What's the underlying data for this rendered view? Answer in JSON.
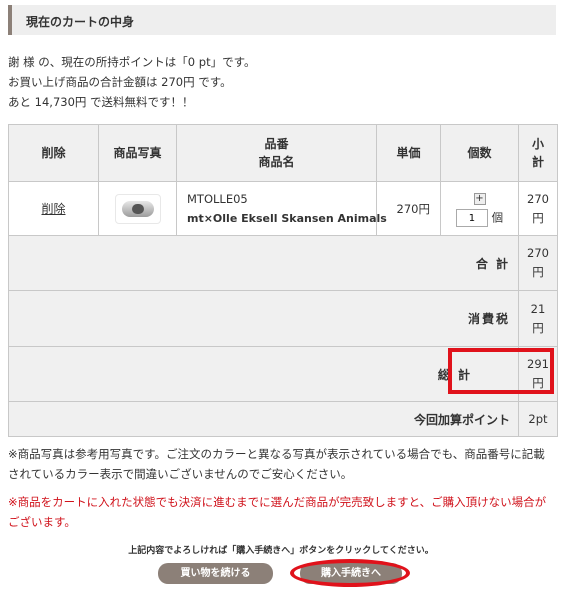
{
  "heading": "現在のカートの中身",
  "intro": {
    "line1": "謝 様 の、現在の所持ポイントは「0 pt」です。",
    "line2": "お買い上げ商品の合計金額は 270円 です。",
    "line3": "あと 14,730円 で送料無料です！！"
  },
  "table": {
    "headers": {
      "delete": "削除",
      "photo": "商品写真",
      "code_line": "品番",
      "name_line": "商品名",
      "unit_price": "単価",
      "quantity": "個数",
      "subtotal_1": "小",
      "subtotal_2": "計"
    },
    "item": {
      "delete_label": "削除",
      "code": "MTOLLE05",
      "name": "mt×Olle Eksell Skansen Animals",
      "unit_price": "270円",
      "plus": "+",
      "quantity": "1",
      "quantity_unit": "個",
      "subtotal_num": "270",
      "subtotal_unit": "円"
    },
    "summary": {
      "total_label": "合 計",
      "total_num": "270",
      "total_unit": "円",
      "tax_label": "消費税",
      "tax_num": "21",
      "tax_unit": "円",
      "grand_label": "総 計",
      "grand_num": "291",
      "grand_unit": "円",
      "points_label": "今回加算ポイント",
      "points_value": "2pt"
    }
  },
  "notes": {
    "photo_note": "※商品写真は参考用写真です。ご注文のカラーと異なる写真が表示されている場合でも、商品番号に記載されているカラー表示で間違いございませんのでご安心ください。",
    "warning": "※商品をカートに入れた状態でも決済に進むまでに選んだ商品が完売致しますと、ご購入頂けない場合がございます。"
  },
  "instruction": "上記内容でよろしければ「購入手続きへ」ボタンをクリックしてください。",
  "buttons": {
    "continue": "買い物を続ける",
    "checkout": "購入手続きへ"
  },
  "colors": {
    "accent_brown": "#8c8078",
    "highlight_red": "#e0121b",
    "warning_red": "#d0121b",
    "header_gray": "#f0f0f0"
  },
  "icons": {
    "product_thumbnail": "masking-tape-roll",
    "quantity_plus": "plus-icon"
  }
}
